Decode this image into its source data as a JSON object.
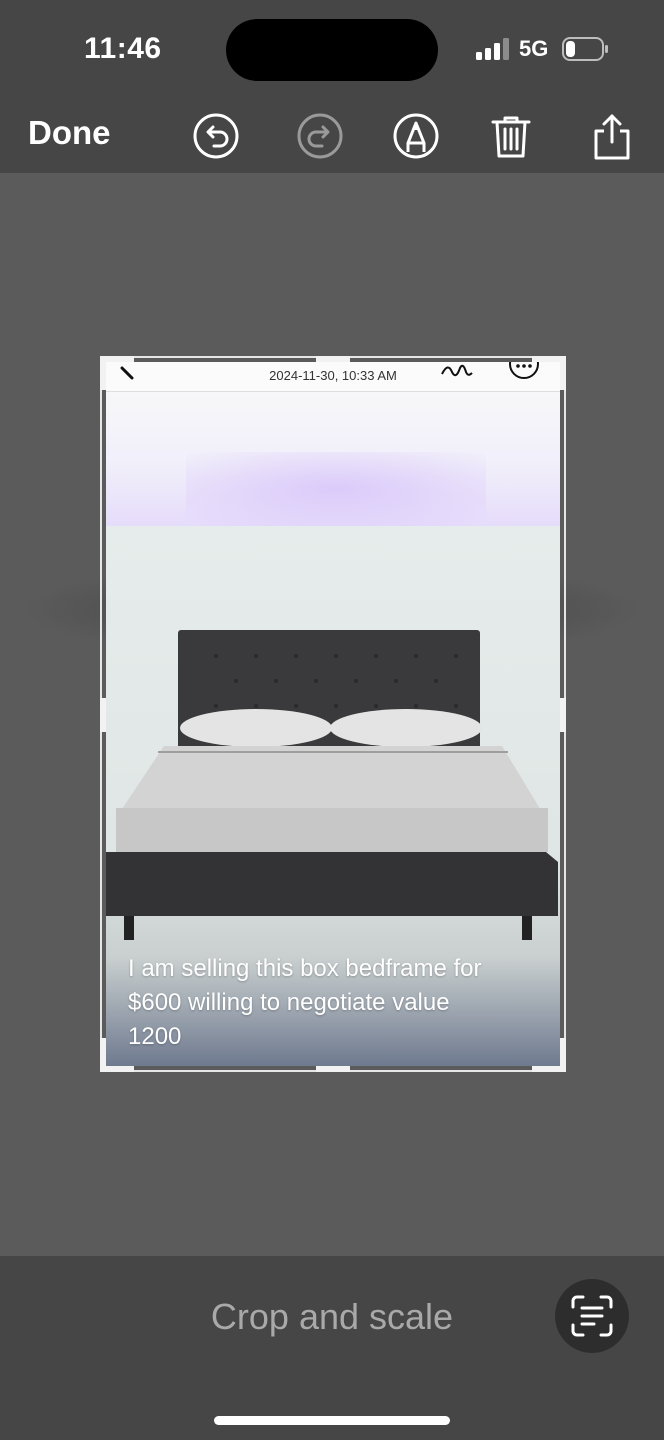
{
  "status_bar": {
    "time": "11:46",
    "network": "5G",
    "battery_level": 0.15
  },
  "toolbar": {
    "done_label": "Done",
    "icons": [
      "undo-icon",
      "redo-icon",
      "markup-pen-icon",
      "trash-icon",
      "share-icon"
    ]
  },
  "photo": {
    "timestamp": "2024-11-30, 10:33 AM",
    "caption_lines": [
      "I am selling this box bedframe for",
      "$600 willing to negotiate value",
      "1200"
    ]
  },
  "bottom": {
    "mode_label": "Crop and scale",
    "scan_icon": "text-scan-icon"
  },
  "colors": {
    "toolbar_bg": "#464646",
    "canvas_bg": "#5b5b5b",
    "disabled_icon": "#9a9a9a",
    "accent_white": "#ffffff"
  }
}
